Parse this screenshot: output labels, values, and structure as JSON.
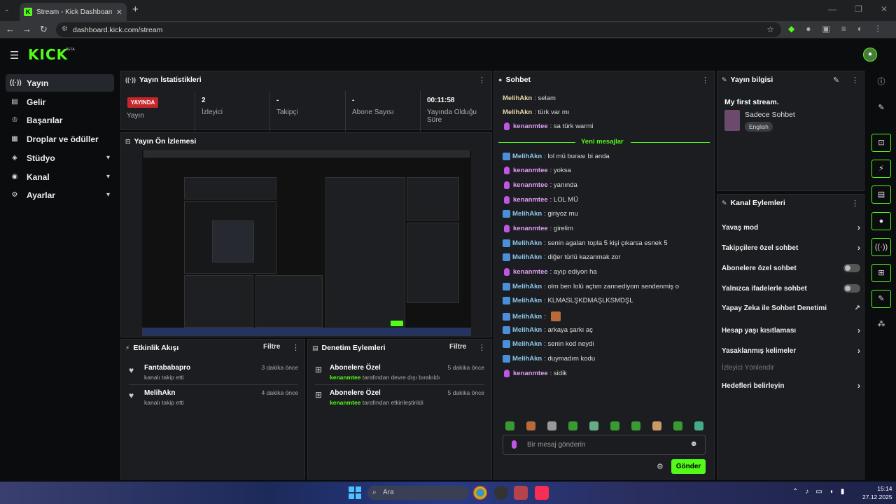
{
  "browser": {
    "tab_title": "Stream - Kick Dashboard",
    "url": "dashboard.kick.com/stream"
  },
  "app": {
    "logo": "KICK",
    "beta": "BETA"
  },
  "sidebar": {
    "items": [
      {
        "label": "Yayın",
        "icon": "broadcast-icon",
        "active": true
      },
      {
        "label": "Gelir",
        "icon": "wallet-icon"
      },
      {
        "label": "Başarılar",
        "icon": "trophy-icon"
      },
      {
        "label": "Droplar ve ödüller",
        "icon": "drops-icon"
      },
      {
        "label": "Stüdyo",
        "icon": "studio-icon",
        "expandable": true
      },
      {
        "label": "Kanal",
        "icon": "channel-icon",
        "expandable": true
      },
      {
        "label": "Ayarlar",
        "icon": "gear-icon",
        "expandable": true
      }
    ]
  },
  "stats": {
    "title": "Yayın İstatistikleri",
    "status": "YAYINDA",
    "status_label": "Yayın",
    "viewers_value": "2",
    "viewers_label": "İzleyici",
    "followers_value": "-",
    "followers_label": "Takipçi",
    "subs_value": "-",
    "subs_label": "Abone Sayısı",
    "uptime_value": "00:11:58",
    "uptime_label": "Yayında Olduğu Süre"
  },
  "preview": {
    "title": "Yayın Ön İzlemesi"
  },
  "activity": {
    "title": "Etkinlik Akışı",
    "filter": "Filtre",
    "items": [
      {
        "name": "Fantababapro",
        "sub": "kanalı takip etti",
        "time": "3 dakika önce"
      },
      {
        "name": "MelihAkn",
        "sub": "kanalı takip etti",
        "time": "4 dakika önce"
      }
    ]
  },
  "moderation": {
    "title": "Denetim Eylemleri",
    "filter": "Filtre",
    "items": [
      {
        "name": "Abonelere Özel",
        "user": "kenanmtee",
        "sub": "tarafından devre dışı bırakıldı",
        "time": "5 dakika önce"
      },
      {
        "name": "Abonelere Özel",
        "user": "kenanmtee",
        "sub": "tarafından etkinleştirildi",
        "time": "5 dakika önce"
      }
    ]
  },
  "chat": {
    "title": "Sohbet",
    "new_messages": "Yeni mesajlar",
    "placeholder": "Bir mesaj gönderin",
    "send": "Gönder",
    "messages": [
      {
        "user": "MelihAkn",
        "text": ": selam",
        "badge": "none",
        "style": "u1"
      },
      {
        "user": "MelihAkn",
        "text": ": türk var mı",
        "badge": "none",
        "style": "u1"
      },
      {
        "user": "kenanmtee",
        "text": ": sa türk warmi",
        "badge": "mic",
        "style": "u3"
      },
      {
        "user": "MelihAkn",
        "text": ": lol mü burası bi anda",
        "badge": "blue",
        "style": "u2"
      },
      {
        "user": "kenanmtee",
        "text": ": yoksa",
        "badge": "mic",
        "style": "u3"
      },
      {
        "user": "kenanmtee",
        "text": ": yanında",
        "badge": "mic",
        "style": "u3"
      },
      {
        "user": "kenanmtee",
        "text": ": LOL MÜ",
        "badge": "mic",
        "style": "u3"
      },
      {
        "user": "MelihAkn",
        "text": ": giriyoz mu",
        "badge": "blue",
        "style": "u2"
      },
      {
        "user": "kenanmtee",
        "text": ": girelim",
        "badge": "mic",
        "style": "u3"
      },
      {
        "user": "MelihAkn",
        "text": ": senin agaları topla 5 kişi çıkarsa esnek 5",
        "badge": "blue",
        "style": "u2"
      },
      {
        "user": "MelihAkn",
        "text": ": diğer türlü kazanmak zor",
        "badge": "blue",
        "style": "u2"
      },
      {
        "user": "kenanmtee",
        "text": ": ayıp ediyon ha",
        "badge": "mic",
        "style": "u3"
      },
      {
        "user": "MelihAkn",
        "text": ": olm ben lolü açtım zannediyom sendenmiş o",
        "badge": "blue",
        "style": "u2"
      },
      {
        "user": "MelihAkn",
        "text": ": KLMASLŞKDMAŞLKSMDŞL",
        "badge": "blue",
        "style": "u2"
      },
      {
        "user": "MelihAkn",
        "text": ":",
        "badge": "blue",
        "style": "u2"
      },
      {
        "user": "MelihAkn",
        "text": ": arkaya şarkı aç",
        "badge": "blue",
        "style": "u2"
      },
      {
        "user": "MelihAkn",
        "text": ": senin kod neydi",
        "badge": "blue",
        "style": "u2"
      },
      {
        "user": "MelihAkn",
        "text": ": duymadım kodu",
        "badge": "blue",
        "style": "u2"
      },
      {
        "user": "kenanmtee",
        "text": ": sidik",
        "badge": "mic",
        "style": "u3"
      }
    ]
  },
  "info": {
    "title": "Yayın bilgisi",
    "stream_title": "My first stream.",
    "category": "Sadece Sohbet",
    "language": "English"
  },
  "channel_actions": {
    "title": "Kanal Eylemleri",
    "items": [
      {
        "label": "Yavaş mod",
        "control": "chevron"
      },
      {
        "label": "Takipçilere özel sohbet",
        "control": "chevron"
      },
      {
        "label": "Abonelere özel sohbet",
        "control": "toggle"
      },
      {
        "label": "Yalnızca ifadelerle sohbet",
        "control": "toggle"
      },
      {
        "label": "Yapay Zeka ile Sohbet Denetimi",
        "control": "external"
      },
      {
        "label": "Hesap yaşı kısıtlaması",
        "control": "chevron"
      },
      {
        "label": "Yasaklanmış kelimeler",
        "control": "chevron"
      },
      {
        "label": "İzleyici Yönlendir",
        "control": "disabled"
      },
      {
        "label": "Hedefleri belirleyin",
        "control": "chevron"
      }
    ]
  },
  "taskbar": {
    "search": "Ara",
    "time": "15:14",
    "date": "27.12.2025"
  },
  "colors": {
    "accent": "#53fc18",
    "live": "#c6262b"
  }
}
